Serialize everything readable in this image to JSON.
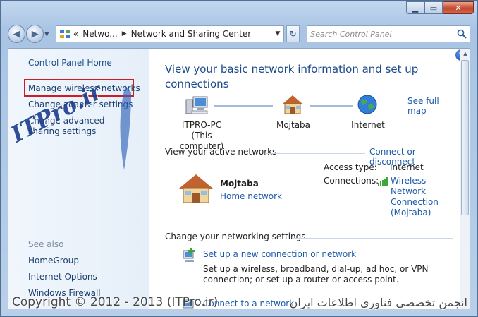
{
  "window": {
    "caption": {
      "minimize": "▁",
      "maximize": "▭",
      "close": "✕"
    }
  },
  "nav": {
    "back": "◀",
    "forward": "▶",
    "drop": "▼",
    "breadcrumb": {
      "prefix": "«",
      "items": [
        "Netwo...",
        "Network and Sharing Center"
      ],
      "separator": "▶"
    },
    "refresh": "↻",
    "search_placeholder": "Search Control Panel"
  },
  "left_pane": {
    "home": "Control Panel Home",
    "links": [
      "Manage wireless networks",
      "Change adapter settings",
      "Change advanced sharing settings"
    ],
    "see_also_title": "See also",
    "see_also": [
      "HomeGroup",
      "Internet Options",
      "Windows Firewall"
    ]
  },
  "main": {
    "help": "?",
    "heading": "View your basic network information and set up connections",
    "see_full_map": "See full map",
    "map_nodes": {
      "computer": {
        "name": "ITPRO-PC",
        "sub": "(This computer)"
      },
      "network": {
        "name": "Mojtaba"
      },
      "internet": {
        "name": "Internet"
      }
    },
    "active": {
      "label": "View your active networks",
      "link": "Connect or disconnect",
      "network_name": "Mojtaba",
      "network_type": "Home network",
      "access_label": "Access type:",
      "access_value": "Internet",
      "connections_label": "Connections:",
      "connection_link": "Wireless Network Connection (Mojtaba)"
    },
    "change": {
      "label": "Change your networking settings",
      "task1_title": "Set up a new connection or network",
      "task1_desc": "Set up a wireless, broadband, dial-up, ad hoc, or VPN connection; or set up a router or access point.",
      "task2_title": "Connect to a network"
    }
  },
  "watermark": {
    "logo": "ITPro.ir",
    "copyright": "Copyright © 2012 - 2013 (ITPro.ir)",
    "persian": "انجمن تخصصی فناوری اطلاعات ایران"
  },
  "colors": {
    "link": "#1e5aa8",
    "heading": "#1b4a8b",
    "highlight": "#d21a22"
  }
}
